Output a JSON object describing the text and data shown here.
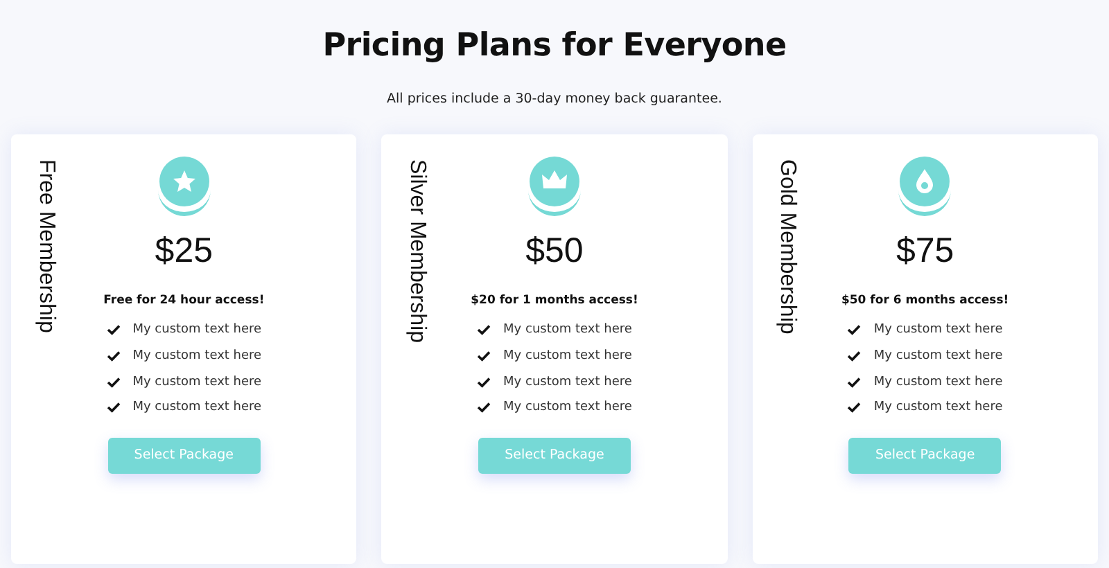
{
  "title": "Pricing Plans for Everyone",
  "subtitle": "All prices include a 30-day money back guarantee.",
  "plans": [
    {
      "name": "Free Membership",
      "price": "$25",
      "access": "Free for 24 hour access!",
      "features": [
        "My custom text here",
        "My custom text here",
        "My custom text here",
        "My custom text here"
      ],
      "button": "Select Package"
    },
    {
      "name": "Silver Membership",
      "price": "$50",
      "access": "$20 for 1 months access!",
      "features": [
        "My custom text here",
        "My custom text here",
        "My custom text here",
        "My custom text here"
      ],
      "button": "Select Package"
    },
    {
      "name": "Gold Membership",
      "price": "$75",
      "access": "$50 for 6 months access!",
      "features": [
        "My custom text here",
        "My custom text here",
        "My custom text here",
        "My custom text here"
      ],
      "button": "Select Package"
    }
  ]
}
